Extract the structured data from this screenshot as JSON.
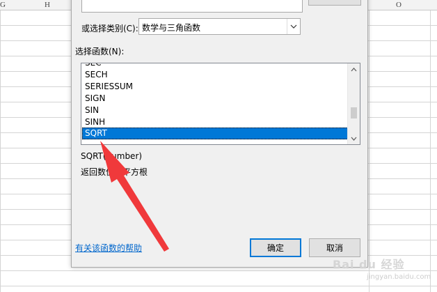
{
  "columns": [
    "G",
    "H",
    "O"
  ],
  "dialog": {
    "category_label": "或选择类别(C):",
    "category_value": "数学与三角函数",
    "function_label": "选择函数(N):",
    "functions": [
      "SEC",
      "SECH",
      "SERIESSUM",
      "SIGN",
      "SIN",
      "SINH",
      "SQRT"
    ],
    "selected_function": "SQRT",
    "syntax": "SQRT(number)",
    "description": "返回数值的平方根",
    "help_link": "有关该函数的帮助",
    "ok_label": "确定",
    "cancel_label": "取消"
  },
  "watermark": {
    "brand": "Bai du 经验",
    "url": "jingyan.baidu.com"
  },
  "colors": {
    "selection": "#0078d7",
    "link": "#0066cc",
    "annotation_arrow": "#f0393b"
  }
}
